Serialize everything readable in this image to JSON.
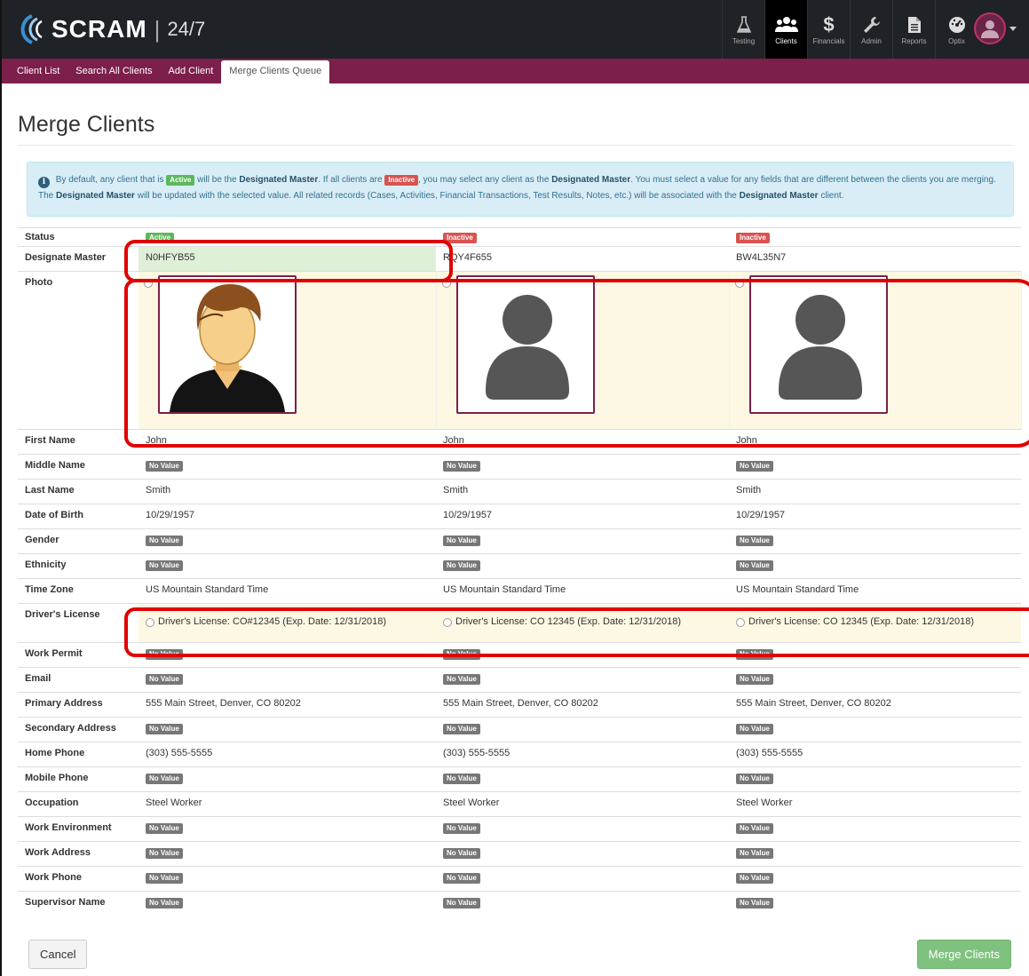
{
  "app": {
    "brand": "SCRAM",
    "sep": "|",
    "version": "24/7"
  },
  "nav": [
    {
      "label": "Testing",
      "icon": "flask-icon"
    },
    {
      "label": "Clients",
      "icon": "users-icon"
    },
    {
      "label": "Financials",
      "icon": "dollar-icon"
    },
    {
      "label": "Admin",
      "icon": "wrench-icon"
    },
    {
      "label": "Reports",
      "icon": "document-icon"
    },
    {
      "label": "Optix",
      "icon": "gauge-icon"
    }
  ],
  "subnav": [
    "Client List",
    "Search All Clients",
    "Add Client",
    "Merge Clients Queue"
  ],
  "page": {
    "title": "Merge Clients"
  },
  "info": {
    "t1": "By default, any client that is",
    "active": "Active",
    "t2": "will be the",
    "designated_master": "Designated Master",
    "t3": ". If all clients are",
    "inactive": "Inactive",
    "t4": ", you may select any client as the",
    "t5": ". You must select a value for any fields that are different between the clients you are merging. The",
    "t6": "will be updated with the selected value. All related records (Cases, Activities, Financial Transactions, Test Results, Notes, etc.) will be associated with the",
    "t7": "client."
  },
  "no_value": "No Value",
  "fields": {
    "status": "Status",
    "designate_master": "Designate Master",
    "photo": "Photo",
    "first_name": "First Name",
    "middle_name": "Middle Name",
    "last_name": "Last Name",
    "dob": "Date of Birth",
    "gender": "Gender",
    "ethnicity": "Ethnicity",
    "time_zone": "Time Zone",
    "drivers_license": "Driver's License",
    "work_permit": "Work Permit",
    "email": "Email",
    "primary_address": "Primary Address",
    "secondary_address": "Secondary Address",
    "home_phone": "Home Phone",
    "mobile_phone": "Mobile Phone",
    "occupation": "Occupation",
    "work_environment": "Work Environment",
    "work_address": "Work Address",
    "work_phone": "Work Phone",
    "supervisor_name": "Supervisor Name"
  },
  "clients": [
    {
      "status": "Active",
      "id": "N0HFYB55",
      "first_name": "John",
      "last_name": "Smith",
      "dob": "10/29/1957",
      "time_zone": "US Mountain Standard Time",
      "drivers_license": "Driver's License: CO#12345 (Exp. Date: 12/31/2018)",
      "primary_address": "555 Main Street, Denver, CO 80202",
      "home_phone": "(303) 555-5555",
      "occupation": "Steel Worker"
    },
    {
      "status": "Inactive",
      "id": "RQY4F655",
      "first_name": "John",
      "last_name": "Smith",
      "dob": "10/29/1957",
      "time_zone": "US Mountain Standard Time",
      "drivers_license": "Driver's License: CO 12345 (Exp. Date: 12/31/2018)",
      "primary_address": "555 Main Street, Denver, CO 80202",
      "home_phone": "(303) 555-5555",
      "occupation": "Steel Worker"
    },
    {
      "status": "Inactive",
      "id": "BW4L35N7",
      "first_name": "John",
      "last_name": "Smith",
      "dob": "10/29/1957",
      "time_zone": "US Mountain Standard Time",
      "drivers_license": "Driver's License: CO 12345 (Exp. Date: 12/31/2018)",
      "primary_address": "555 Main Street, Denver, CO 80202",
      "home_phone": "(303) 555-5555",
      "occupation": "Steel Worker"
    }
  ],
  "buttons": {
    "cancel": "Cancel",
    "merge": "Merge Clients"
  },
  "colors": {
    "topbar": "#1f2227",
    "subnav": "#7c1f4a",
    "active": "#5cb85c",
    "inactive": "#d9534f",
    "highlight": "#e00000",
    "merge_button": "#7fc27f"
  }
}
